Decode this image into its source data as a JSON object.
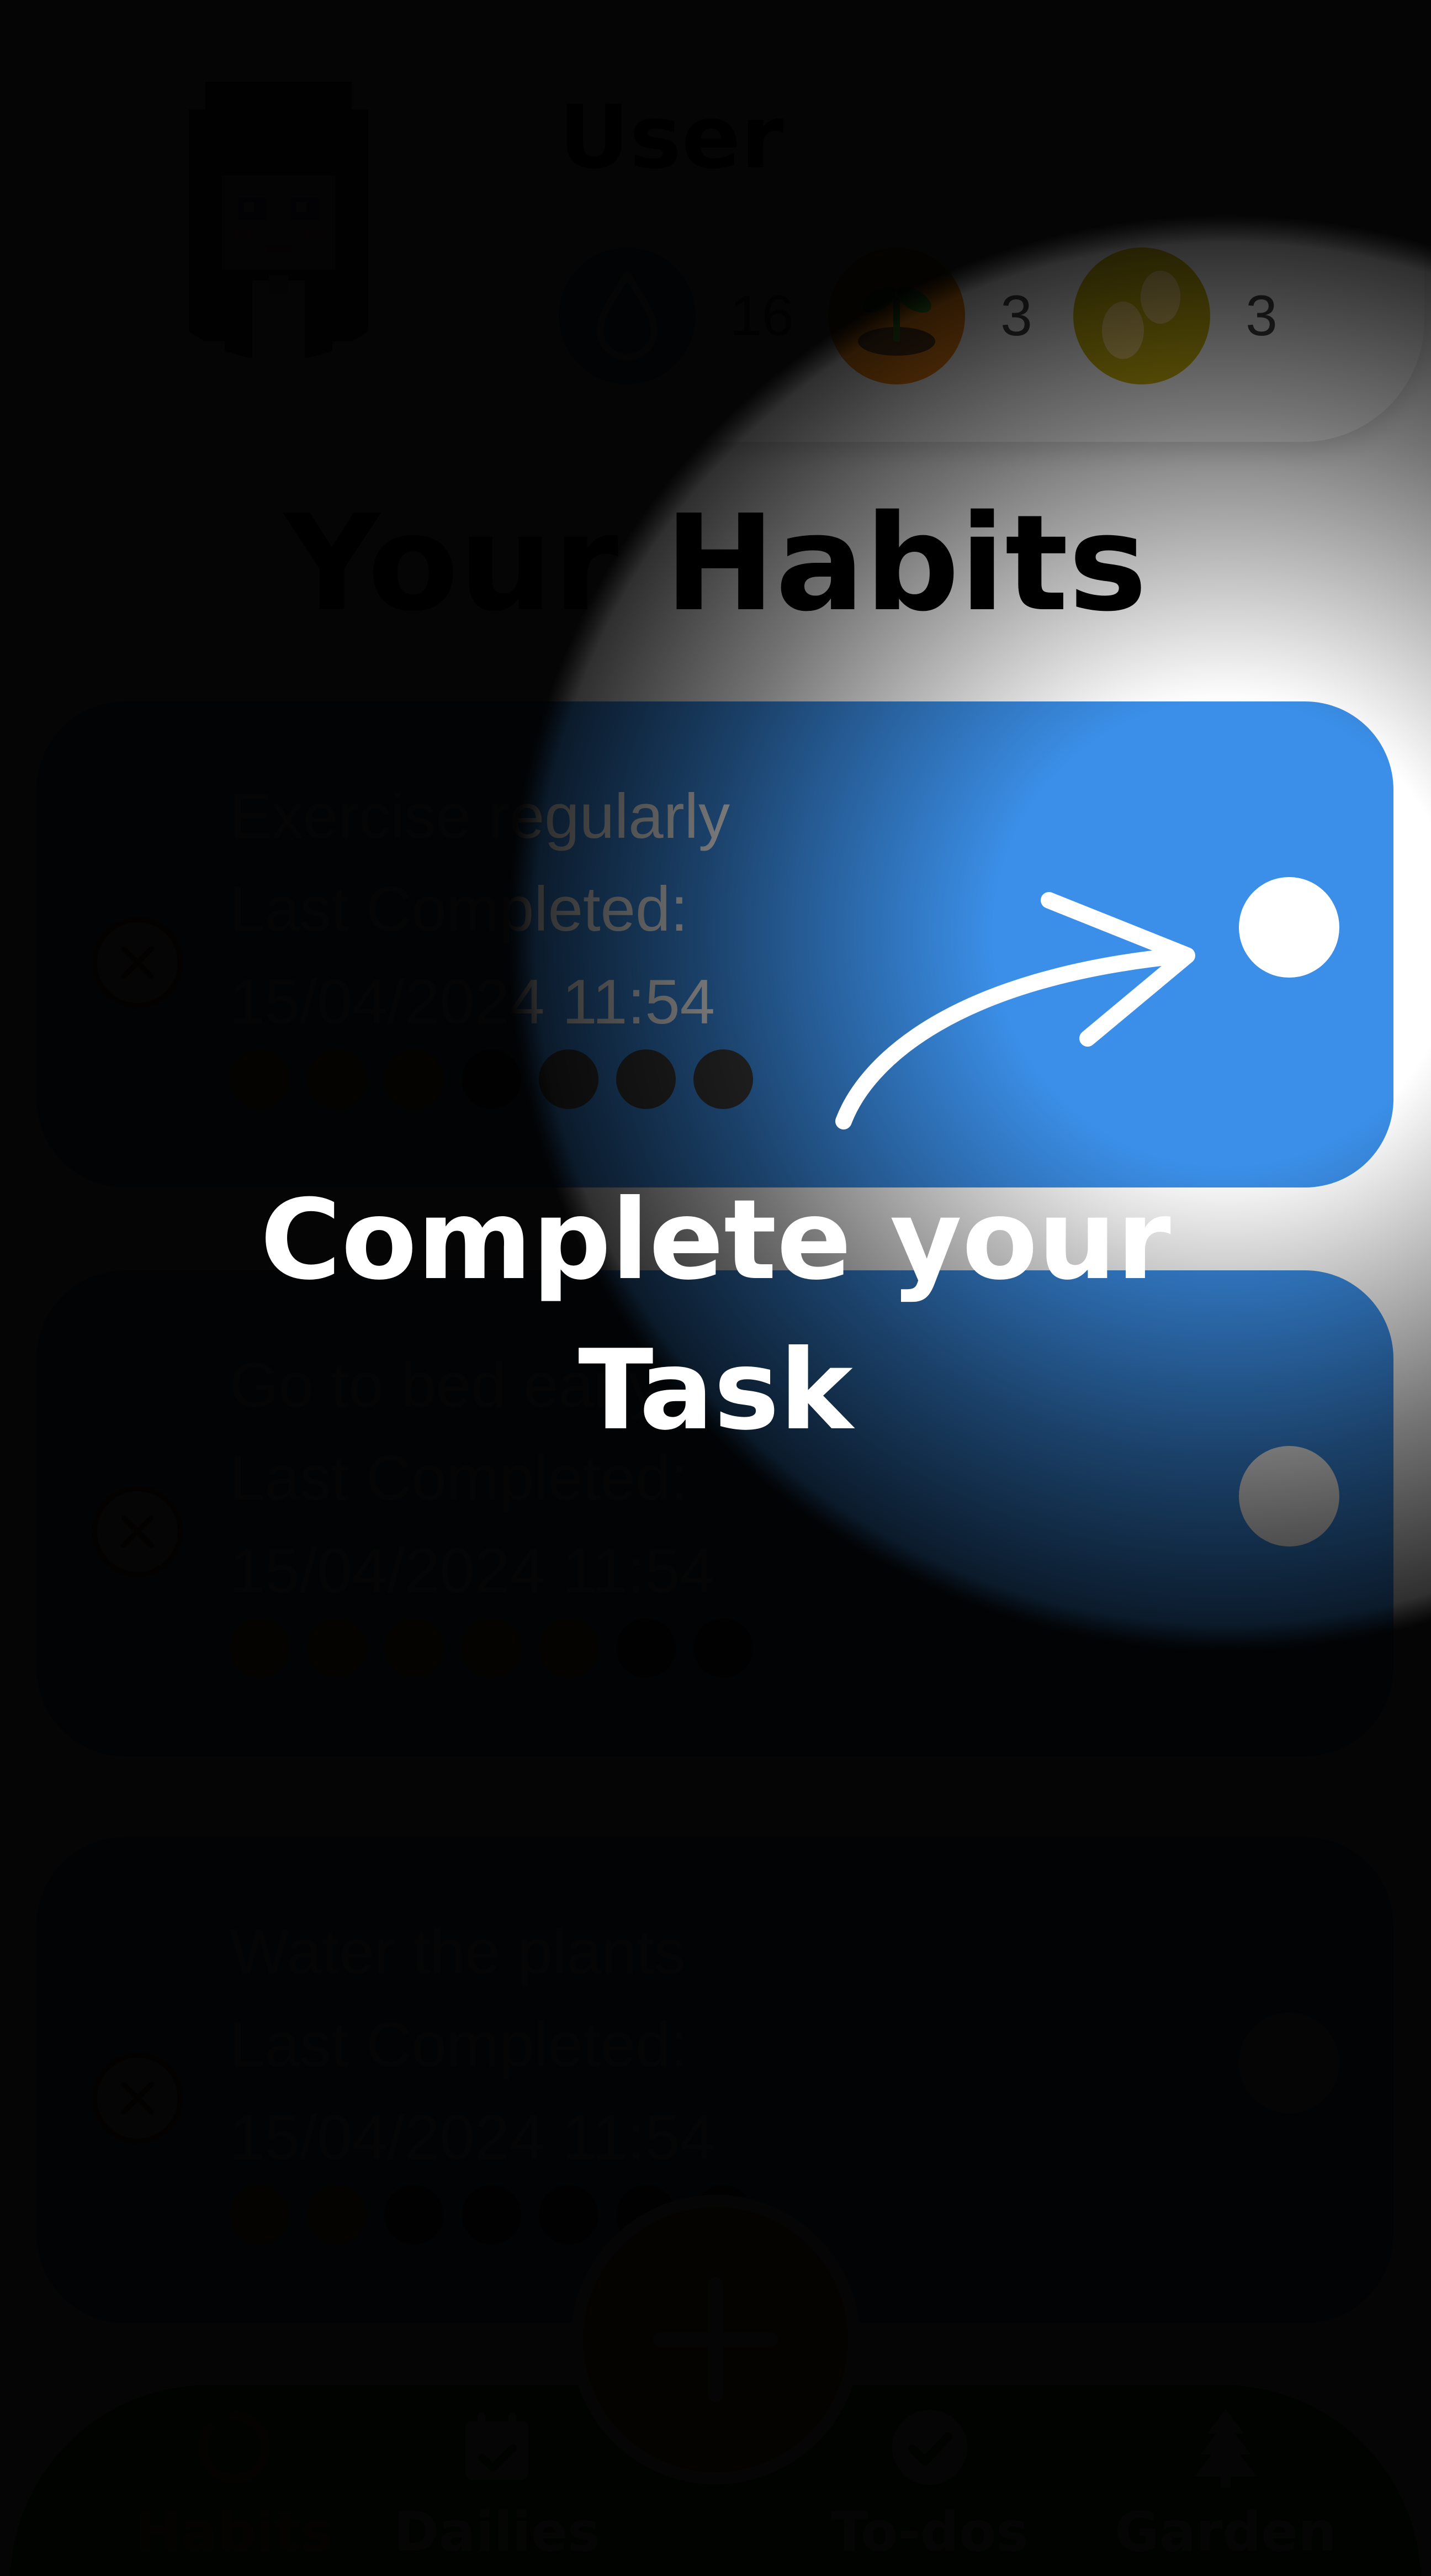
{
  "user": {
    "name": "User",
    "stats": [
      {
        "icon": "water-drop-icon",
        "color": "#1b9ad6",
        "count": "16"
      },
      {
        "icon": "seedling-icon",
        "color": "#f08413",
        "count": "3"
      },
      {
        "icon": "seeds-icon",
        "color": "#c9b20e",
        "count": "3"
      }
    ]
  },
  "page_title": "Your Habits",
  "habits": [
    {
      "name": "Exercise regularly",
      "last_completed_label": "Last Completed:",
      "last_completed_value": "15/04/2024 11:54",
      "streak": [
        1,
        1,
        1,
        0,
        0,
        0,
        0
      ]
    },
    {
      "name": "Go to bed early",
      "last_completed_label": "Last Completed:",
      "last_completed_value": "15/04/2024 11:54",
      "streak": [
        1,
        1,
        1,
        1,
        1,
        0,
        0
      ]
    },
    {
      "name": "Water the plants",
      "last_completed_label": "Last Completed:",
      "last_completed_value": "15/04/2024 11:54",
      "streak": [
        1,
        1,
        0,
        0,
        0,
        0,
        0
      ]
    }
  ],
  "nav": {
    "items": [
      {
        "label": "Habits",
        "icon": "habits-ring-icon",
        "active": true
      },
      {
        "label": "Dailies",
        "icon": "calendar-check-icon",
        "active": false
      },
      {
        "label": "To-dos",
        "icon": "checkmark-circle-icon",
        "active": false
      },
      {
        "label": "Garden",
        "icon": "tree-icon",
        "active": false
      }
    ],
    "add_icon": "plus-icon"
  },
  "tutorial": {
    "line1": "Complete your",
    "line2": "Task"
  },
  "colors": {
    "card": "#3b8fe8",
    "accent": "#f08413",
    "nav": "#3f8a18",
    "delete": "#d63a3a",
    "streak_on": "#f08413",
    "streak_off": "#3a3a3a"
  }
}
